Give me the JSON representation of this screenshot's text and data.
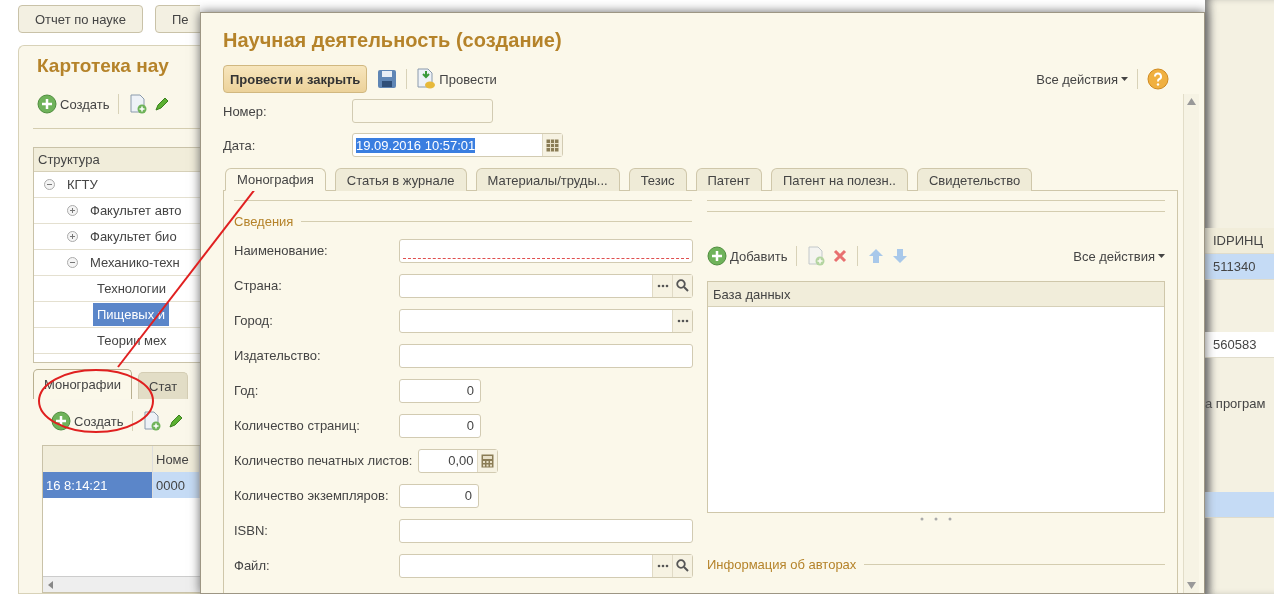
{
  "background_window": {
    "top_tabs": [
      {
        "label": "Отчет по науке"
      },
      {
        "label": "Пе"
      }
    ],
    "title": "Картотека нау",
    "toolbar": {
      "create": "Создать"
    },
    "tree": {
      "header": "Структура",
      "items": [
        {
          "label": "КГТУ",
          "expanded": true,
          "selected": false,
          "children": [
            {
              "label": "Факультет авто",
              "expanded": false,
              "selected": false
            },
            {
              "label": "Факультет био",
              "expanded": false,
              "selected": false
            },
            {
              "label": "Механико-техн",
              "expanded": true,
              "selected": false,
              "children": [
                {
                  "label": "Технологии",
                  "selected": false
                },
                {
                  "label": "Пищевых и",
                  "selected": true
                },
                {
                  "label": "Теории мех",
                  "selected": false
                }
              ]
            }
          ]
        }
      ]
    },
    "tabs": [
      {
        "label": "Монографии",
        "selected": true
      },
      {
        "label": "Стат",
        "selected": false
      }
    ],
    "list_toolbar": {
      "create": "Создать"
    },
    "table": {
      "columns": [
        "",
        "Номе"
      ],
      "rows": [
        {
          "cells": [
            "16 8:14:21",
            "0000"
          ],
          "selected": true
        }
      ]
    },
    "right_table": {
      "column": "IDРИНЦ",
      "rows": [
        {
          "value": "511340",
          "selected": true
        },
        {
          "value": "560583",
          "selected": false
        }
      ]
    },
    "right_tab": {
      "label": "а програм"
    }
  },
  "dialog": {
    "title": "Научная деятельность (создание)",
    "toolbar": {
      "primary": "Провести и закрыть",
      "post": "Провести",
      "all_actions": "Все действия"
    },
    "header_fields": [
      {
        "label": "Номер:"
      },
      {
        "label": "Дата:",
        "value": "19.09.2016 10:57:01",
        "selected": true
      }
    ],
    "tabs": [
      {
        "label": "Монография",
        "selected": true
      },
      {
        "label": "Статья в журнале",
        "selected": false
      },
      {
        "label": "Материалы/труды...",
        "selected": false
      },
      {
        "label": "Тезис",
        "selected": false
      },
      {
        "label": "Патент",
        "selected": false
      },
      {
        "label": "Патент на полезн..",
        "selected": false
      },
      {
        "label": "Свидетельство",
        "selected": false
      }
    ],
    "details": {
      "title": "Сведения",
      "fields": [
        {
          "label": "Наименование:",
          "kind": "text",
          "required": true
        },
        {
          "label": "Страна:",
          "kind": "lookup",
          "required": false
        },
        {
          "label": "Город:",
          "kind": "choice",
          "required": false
        },
        {
          "label": "Издательство:",
          "kind": "text",
          "required": false
        },
        {
          "label": "Год:",
          "kind": "number",
          "value": "0",
          "required": false
        },
        {
          "label": "Количество страниц:",
          "kind": "number",
          "value": "0",
          "required": false
        },
        {
          "label": "Количество печатных листов:",
          "kind": "calc",
          "value": "0,00",
          "required": false
        },
        {
          "label": "Количество экземпляров:",
          "kind": "number",
          "value": "0",
          "required": false
        },
        {
          "label": "ISBN:",
          "kind": "text",
          "required": false
        },
        {
          "label": "Файл:",
          "kind": "lookup",
          "required": false
        }
      ]
    },
    "database": {
      "toolbar": {
        "add": "Добавить",
        "all_actions": "Все действия"
      },
      "table": {
        "columns": [
          "База данных"
        ]
      }
    },
    "authors": {
      "title": "Информация об авторах"
    }
  }
}
